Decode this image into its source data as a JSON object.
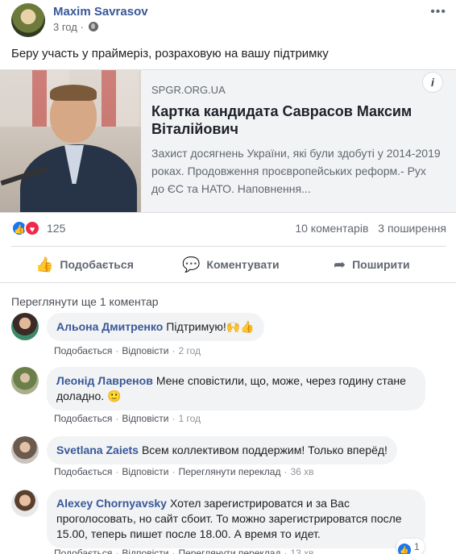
{
  "post": {
    "author": "Maxim Savrasov",
    "time": "3 год",
    "more_label": "•••",
    "text": "Беру участь у праймеріз, розраховую на вашу підтримку"
  },
  "link": {
    "domain": "SPGR.ORG.UA",
    "title": "Картка кандидата Саврасов Максим Віталійович",
    "description": "Захист досягнень України, які були здобуті у 2014-2019 роках. Продовження проєвропейських реформ.- Рух до ЄС та НАТО. Наповнення...",
    "info_label": "i"
  },
  "stats": {
    "reactions": "125",
    "comments": "10 коментарів",
    "shares": "3 поширення"
  },
  "actions": {
    "like": "Подобається",
    "comment": "Коментувати",
    "share": "Поширити"
  },
  "view_more": "Переглянути ще 1 коментар",
  "comments": [
    {
      "author": "Альона Дмитренко",
      "text": "Підтримую!🙌👍",
      "like": "Подобається",
      "reply": "Відповісти",
      "time": "2 год"
    },
    {
      "author": "Леонід Лавренов",
      "text": "Мене сповістили, що, може, через годину стане доладно. 🙂",
      "like": "Подобається",
      "reply": "Відповісти",
      "time": "1 год"
    },
    {
      "author": "Svetlana Zaiets",
      "text": "Всем коллективом поддержим! Только вперёд!",
      "like": "Подобається",
      "reply": "Відповісти",
      "translate": "Переглянути переклад",
      "time": "36 хв"
    },
    {
      "author": "Alexey Chornyavsky",
      "text": "Хотел зарегистрироватся и за Вас проголосовать, но сайт сбоит. То можно зарегистрироватся после 15.00, теперь пишет после 18.00. А время то идет.",
      "like": "Подобається",
      "reply": "Відповісти",
      "translate": "Переглянути переклад",
      "time": "13 хв",
      "reactions": "1"
    }
  ],
  "colors": {
    "link_blue": "#385898",
    "like_blue": "#1877f2",
    "love_red": "#f02849"
  }
}
